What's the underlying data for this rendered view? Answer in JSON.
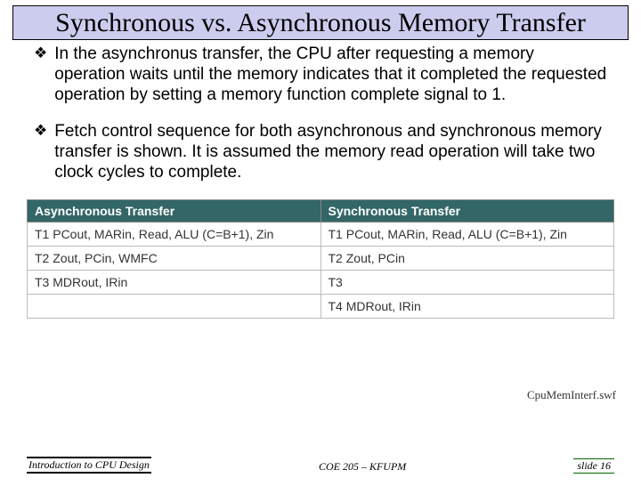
{
  "title": "Synchronous vs. Asynchronous Memory Transfer",
  "bullets": [
    "In the asynchronus transfer, the CPU after requesting a memory operation waits until the memory indicates that it completed the requested operation by setting a memory function complete signal to 1.",
    "Fetch control sequence for both asynchronous and synchronous memory transfer is shown. It is assumed the memory read operation will take two clock cycles to complete."
  ],
  "table": {
    "headers": [
      "Asynchronous Transfer",
      "Synchronous Transfer"
    ],
    "rows": [
      [
        "T1 PCout, MARin, Read, ALU (C=B+1), Zin",
        "T1 PCout, MARin, Read, ALU (C=B+1), Zin"
      ],
      [
        "T2 Zout, PCin, WMFC",
        "T2 Zout, PCin"
      ],
      [
        "T3 MDRout, IRin",
        "T3"
      ],
      [
        "",
        "T4 MDRout, IRin"
      ]
    ]
  },
  "swf_label": "CpuMemInterf.swf",
  "footer": {
    "left": "Introduction to CPU Design",
    "mid": "COE 205 – KFUPM",
    "right": "slide 16"
  }
}
